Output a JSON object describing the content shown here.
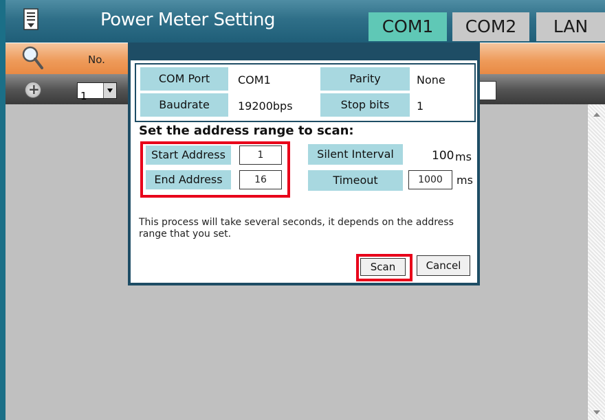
{
  "header": {
    "title": "Power Meter Setting",
    "tabs": [
      {
        "label": "COM1",
        "active": true
      },
      {
        "label": "COM2",
        "active": false
      },
      {
        "label": "LAN",
        "active": false
      }
    ]
  },
  "table_header": {
    "col_no": "No."
  },
  "toolbar": {
    "selected_value": "1"
  },
  "dialog": {
    "info": {
      "com_port_label": "COM Port",
      "com_port_value": "COM1",
      "parity_label": "Parity",
      "parity_value": "None",
      "baudrate_label": "Baudrate",
      "baudrate_value": "19200bps",
      "stop_bits_label": "Stop bits",
      "stop_bits_value": "1"
    },
    "heading": "Set the address range to scan:",
    "start_address_label": "Start Address",
    "start_address_value": "1",
    "end_address_label": "End Address",
    "end_address_value": "16",
    "silent_interval_label": "Silent Interval",
    "silent_interval_value": "100",
    "silent_interval_unit": "ms",
    "timeout_label": "Timeout",
    "timeout_value": "1000",
    "timeout_unit": "ms",
    "note": "This process will take several seconds, it depends on the address range that you set.",
    "scan_label": "Scan",
    "cancel_label": "Cancel"
  },
  "colors": {
    "accent_tab": "#5fc8b6",
    "highlight": "#e8001a",
    "label_bg": "#a8d8e0"
  }
}
